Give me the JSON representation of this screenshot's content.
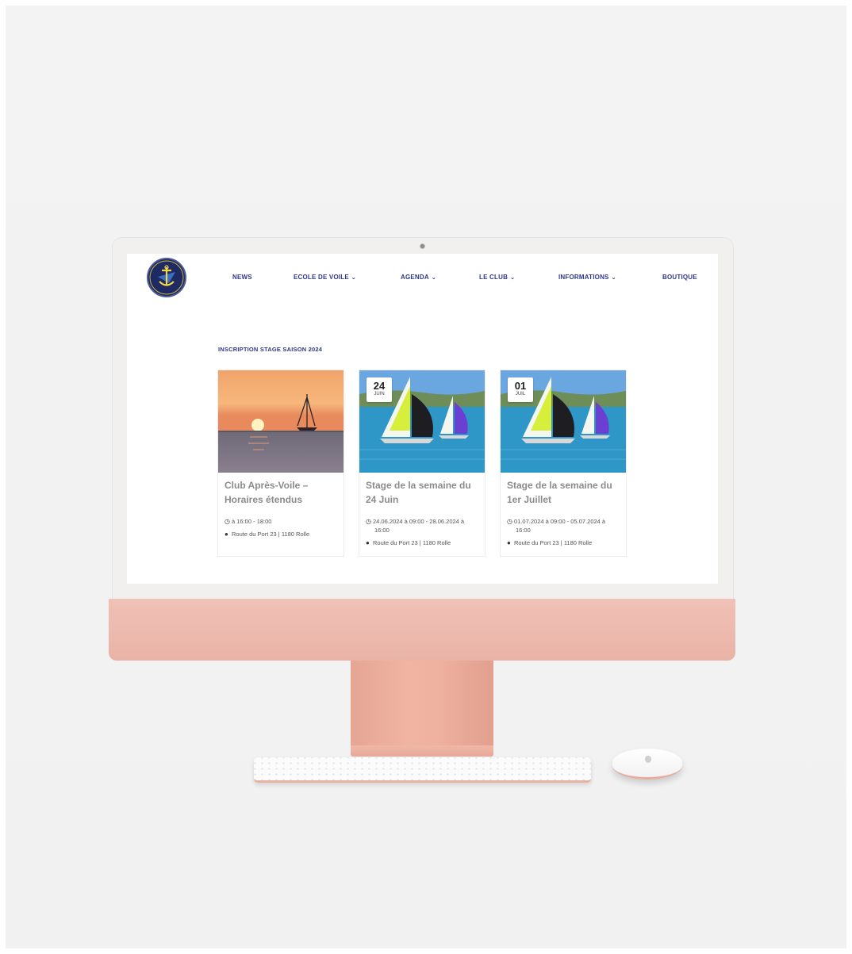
{
  "site": {
    "logo_name": "club-logo",
    "nav": [
      {
        "label": "NEWS",
        "dropdown": false
      },
      {
        "label": "ECOLE DE VOILE",
        "dropdown": true
      },
      {
        "label": "AGENDA",
        "dropdown": true
      },
      {
        "label": "LE CLUB",
        "dropdown": true
      },
      {
        "label": "INFORMATIONS",
        "dropdown": true
      },
      {
        "label": "BOUTIQUE",
        "dropdown": false
      }
    ],
    "section_title": "INSCRIPTION STAGE SAISON 2024",
    "cards": [
      {
        "title": "Club Après-Voile – Horaires étendus",
        "time": "à 16:00 - 18:00",
        "time_cont": "",
        "location": "Route du Port 23 | 1180 Rolle",
        "date_day": "",
        "date_month": "",
        "image": "sunset-sailboat"
      },
      {
        "title": "Stage de la semaine du 24 Juin",
        "time": "24.06.2024 à 09:00 - 28.06.2024 à",
        "time_cont": "16:00",
        "location": "Route du Port 23 | 1180 Rolle",
        "date_day": "24",
        "date_month": "JUIN",
        "image": "sailboats-lake"
      },
      {
        "title": "Stage de la semaine du 1er Juillet",
        "time": "01.07.2024 à 09:00 - 05.07.2024 à",
        "time_cont": "16:00",
        "location": "Route du Port 23 | 1180 Rolle",
        "date_day": "01",
        "date_month": "JUIL",
        "image": "sailboats-lake"
      }
    ]
  },
  "colors": {
    "nav": "#2f3887",
    "card_title": "#8b8b8b",
    "imac_body": "#e9b3a7"
  },
  "icons": {
    "clock": "clock-icon",
    "location": "map-pin-icon",
    "chevron": "chevron-down-icon"
  }
}
